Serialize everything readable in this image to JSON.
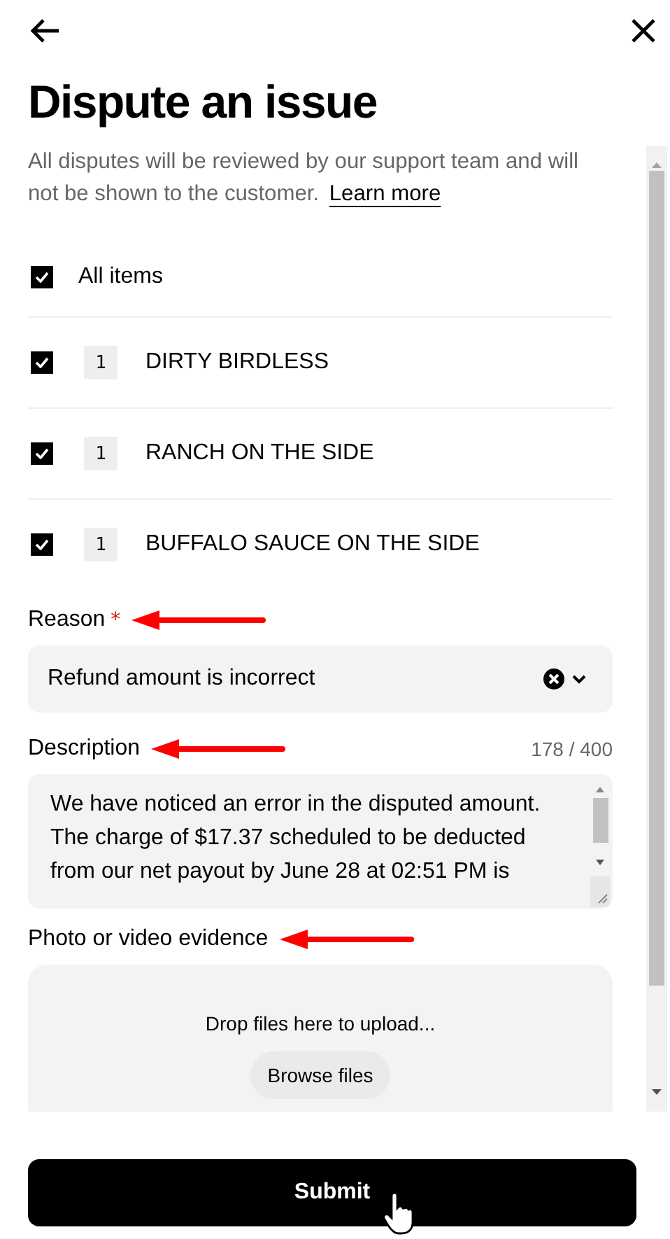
{
  "title": "Dispute an issue",
  "intro": {
    "text": "All disputes will be reviewed by our support team and will not be shown to the customer.",
    "link": "Learn more"
  },
  "items": [
    {
      "kind": "all",
      "label": "All items",
      "checked": true
    },
    {
      "kind": "item",
      "quantity": "1",
      "label": "DIRTY BIRDLESS",
      "checked": true
    },
    {
      "kind": "item",
      "quantity": "1",
      "label": "RANCH ON THE SIDE",
      "checked": true
    },
    {
      "kind": "item",
      "quantity": "1",
      "label": "BUFFALO SAUCE ON THE SIDE",
      "checked": true
    }
  ],
  "reason": {
    "label": "Reason",
    "required_mark": "*",
    "value": "Refund amount is incorrect"
  },
  "description": {
    "label": "Description",
    "counter": "178 / 400",
    "value": "We have noticed an error in the disputed amount. The charge of $17.37 scheduled to be deducted from our net payout by June 28 at 02:51 PM is"
  },
  "evidence": {
    "label": "Photo or video evidence",
    "drop_text": "Drop files here to upload...",
    "browse": "Browse files"
  },
  "submit": "Submit"
}
